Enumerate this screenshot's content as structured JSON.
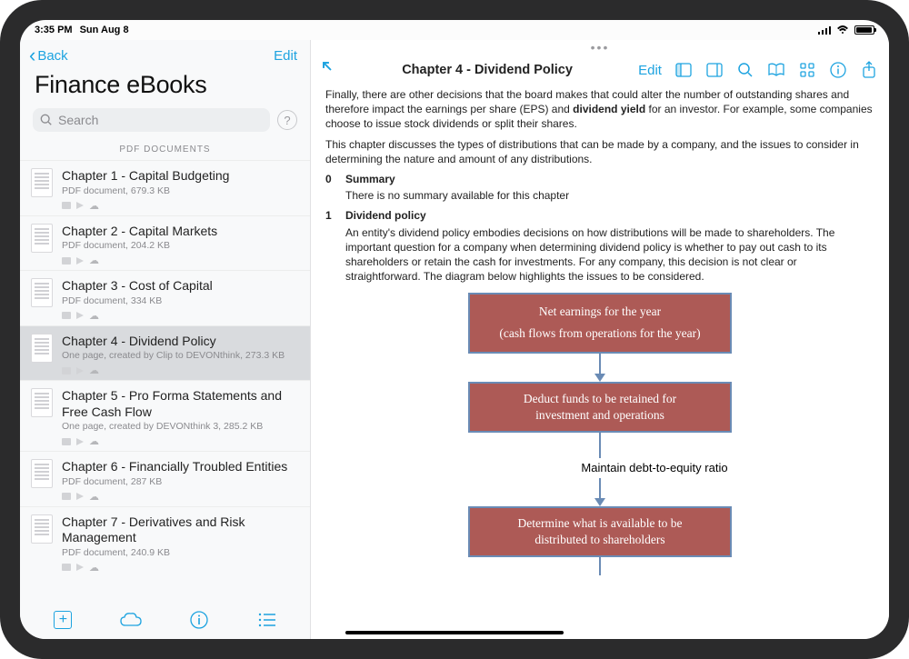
{
  "status": {
    "time": "3:35 PM",
    "date": "Sun Aug 8"
  },
  "sidebar": {
    "back_label": "Back",
    "edit_label": "Edit",
    "title": "Finance eBooks",
    "search_placeholder": "Search",
    "section_header": "PDF DOCUMENTS",
    "items": [
      {
        "title": "Chapter 1 - Capital Budgeting",
        "sub": "PDF document, 679.3 KB",
        "selected": false
      },
      {
        "title": "Chapter 2 - Capital Markets",
        "sub": "PDF document, 204.2 KB",
        "selected": false
      },
      {
        "title": "Chapter 3 - Cost of Capital",
        "sub": "PDF document, 334 KB",
        "selected": false
      },
      {
        "title": "Chapter 4 - Dividend Policy",
        "sub": "One page, created by Clip to DEVONthink, 273.3 KB",
        "selected": true
      },
      {
        "title": "Chapter 5 - Pro Forma Statements and Free Cash Flow",
        "sub": "One page, created by DEVONthink 3, 285.2 KB",
        "selected": false
      },
      {
        "title": "Chapter 6 - Financially Troubled Entities",
        "sub": "PDF document, 287 KB",
        "selected": false
      },
      {
        "title": "Chapter 7 - Derivatives and Risk Management",
        "sub": "PDF document, 240.9 KB",
        "selected": false
      }
    ]
  },
  "content": {
    "title": "Chapter 4 - Dividend Policy",
    "edit_label": "Edit",
    "para1_a": "Finally, there are other decisions that the board makes that could alter the number of outstanding shares and therefore impact the earnings per share (EPS) and ",
    "para1_bold": "dividend yield",
    "para1_b": " for an investor. For example, some companies choose to issue stock dividends or split their shares.",
    "para2": "This chapter discusses the types of distributions that can be made by a company, and the issues to consider in determining the nature and amount of any distributions.",
    "s0_num": "0",
    "s0_title": "Summary",
    "s0_body": "There is no summary available for this chapter",
    "s1_num": "1",
    "s1_title": "Dividend policy",
    "s1_body": "An entity's dividend policy embodies decisions on how distributions will be made to shareholders. The important question for a company when determining dividend policy is whether to pay out cash to its shareholders or retain the cash for investments. For any company, this decision is not clear or straightforward. The diagram below highlights the issues to be considered.",
    "flow": {
      "box1a": "Net earnings for the year",
      "box1b": "(cash flows from operations for the year)",
      "box2a": "Deduct funds to be retained for",
      "box2b": "investment and operations",
      "label": "Maintain debt-to-equity ratio",
      "box3a": "Determine what is available to be",
      "box3b": "distributed to shareholders"
    }
  }
}
